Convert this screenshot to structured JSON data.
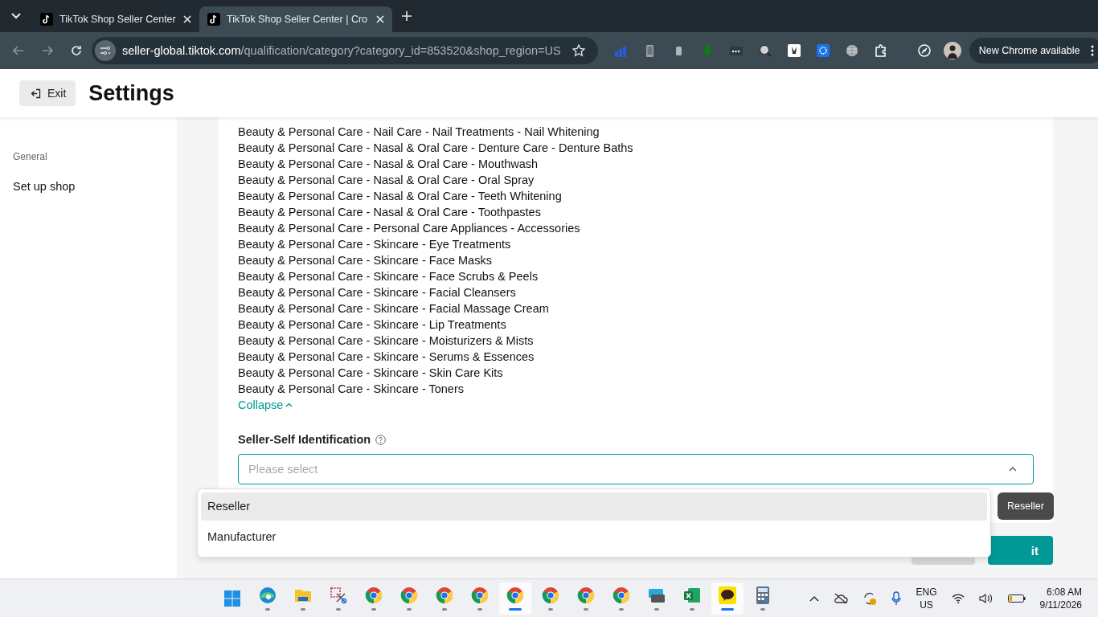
{
  "browser": {
    "tabs": [
      {
        "title": "TikTok Shop Seller Center",
        "selected": false
      },
      {
        "title": "TikTok Shop Seller Center | Cro",
        "selected": true
      }
    ],
    "url_host": "seller-global.tiktok.com",
    "url_path": "/qualification/category?category_id=853520&shop_region=US",
    "update_button": "New Chrome available"
  },
  "header": {
    "exit_button": "Exit",
    "title": "Settings"
  },
  "sidebar": {
    "section": "General",
    "items": [
      {
        "label": "Set up shop"
      }
    ]
  },
  "categories": [
    "Beauty & Personal Care - Nail Care - Nail Treatments - Nail Whitening",
    "Beauty & Personal Care - Nasal & Oral Care - Denture Care - Denture Baths",
    "Beauty & Personal Care - Nasal & Oral Care - Mouthwash",
    "Beauty & Personal Care - Nasal & Oral Care - Oral Spray",
    "Beauty & Personal Care - Nasal & Oral Care - Teeth Whitening",
    "Beauty & Personal Care - Nasal & Oral Care - Toothpastes",
    "Beauty & Personal Care - Personal Care Appliances - Accessories",
    "Beauty & Personal Care - Skincare - Eye Treatments",
    "Beauty & Personal Care - Skincare - Face Masks",
    "Beauty & Personal Care - Skincare - Face Scrubs & Peels",
    "Beauty & Personal Care - Skincare - Facial Cleansers",
    "Beauty & Personal Care - Skincare - Facial Massage Cream",
    "Beauty & Personal Care - Skincare - Lip Treatments",
    "Beauty & Personal Care - Skincare - Moisturizers & Mists",
    "Beauty & Personal Care - Skincare - Serums & Essences",
    "Beauty & Personal Care - Skincare - Skin Care Kits",
    "Beauty & Personal Care - Skincare - Toners"
  ],
  "collapse_link": "Collapse",
  "identification": {
    "label": "Seller-Self Identification",
    "placeholder": "Please select",
    "expanded": true,
    "options": [
      {
        "label": "Reseller",
        "selected": true
      },
      {
        "label": "Manufacturer",
        "selected": false
      }
    ],
    "tooltip": "Reseller"
  },
  "submit_button": "it",
  "taskbar": {
    "apps": [
      {
        "kind": "windows",
        "active": false
      },
      {
        "kind": "edge",
        "active": false
      },
      {
        "kind": "folder",
        "active": false
      },
      {
        "kind": "snip",
        "active": false
      },
      {
        "kind": "chrome",
        "active": false
      },
      {
        "kind": "chrome",
        "active": false
      },
      {
        "kind": "chrome",
        "active": false
      },
      {
        "kind": "chrome",
        "active": false
      },
      {
        "kind": "chrome",
        "active": true
      },
      {
        "kind": "chrome",
        "active": false
      },
      {
        "kind": "chrome",
        "active": false
      },
      {
        "kind": "chrome",
        "active": false
      },
      {
        "kind": "keyboard",
        "active": false
      },
      {
        "kind": "excel",
        "active": false
      },
      {
        "kind": "chat",
        "active": true
      },
      {
        "kind": "calculator",
        "active": false
      }
    ],
    "language": "ENG",
    "region": "US",
    "time": "6:08 AM",
    "date": "9/11/2026"
  }
}
